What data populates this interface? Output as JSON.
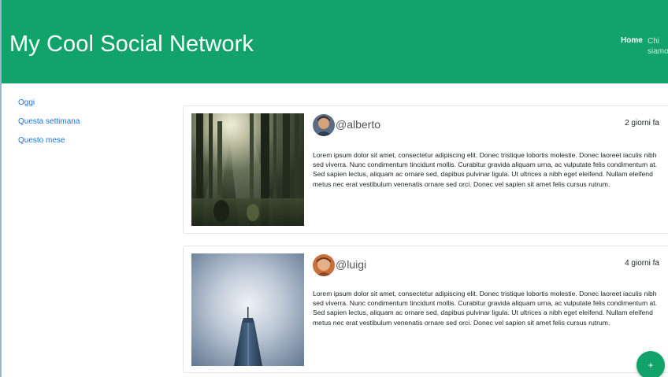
{
  "header": {
    "brand": "My Cool Social Network",
    "nav": [
      {
        "label": "Home"
      },
      {
        "label": "Chi siamo"
      }
    ]
  },
  "sidebar": {
    "items": [
      {
        "label": "Oggi"
      },
      {
        "label": "Questa settimana"
      },
      {
        "label": "Questo mese"
      }
    ]
  },
  "posts": [
    {
      "username": "@alberto",
      "time": "2 giorni fa",
      "text": "Lorem ipsum dolor sit amet, consectetur adipiscing elit. Donec tristique lobortis molestie. Donec laoreet iaculis nibh sed viverra. Nunc condimentum tincidunt mollis. Curabitur gravida aliquam urna, ac vulputate felis condimentum at. Sed sapien lectus, aliquam ac ornare sed, dapibus pulvinar ligula. Ut ultrices a nibh eget eleifend. Nullam eleifend metus nec erat vestibulum venenatis ornare sed orci. Donec vel sapien sit amet felis cursus rutrum.",
      "image": "forest-photo",
      "avatar": "user-avatar"
    },
    {
      "username": "@luigi",
      "time": "4 giorni fa",
      "text": "Lorem ipsum dolor sit amet, consectetur adipiscing elit. Donec tristique lobortis molestie. Donec laoreet iaculis nibh sed viverra. Nunc condimentum tincidunt mollis. Curabitur gravida aliquam urna, ac vulputate felis condimentum at. Sed sapien lectus, aliquam ac ornare sed, dapibus pulvinar ligula. Ut ultrices a nibh eget eleifend. Nullam eleifend metus nec erat vestibulum venenatis ornare sed orci. Donec vel sapien sit amet felis cursus rutrum.",
      "image": "skyscraper-photo",
      "avatar": "user-avatar"
    }
  ],
  "fab": {
    "label": "+"
  },
  "colors": {
    "primary": "#12a36a",
    "link": "#1a73e8",
    "border": "#e3e6e8"
  }
}
